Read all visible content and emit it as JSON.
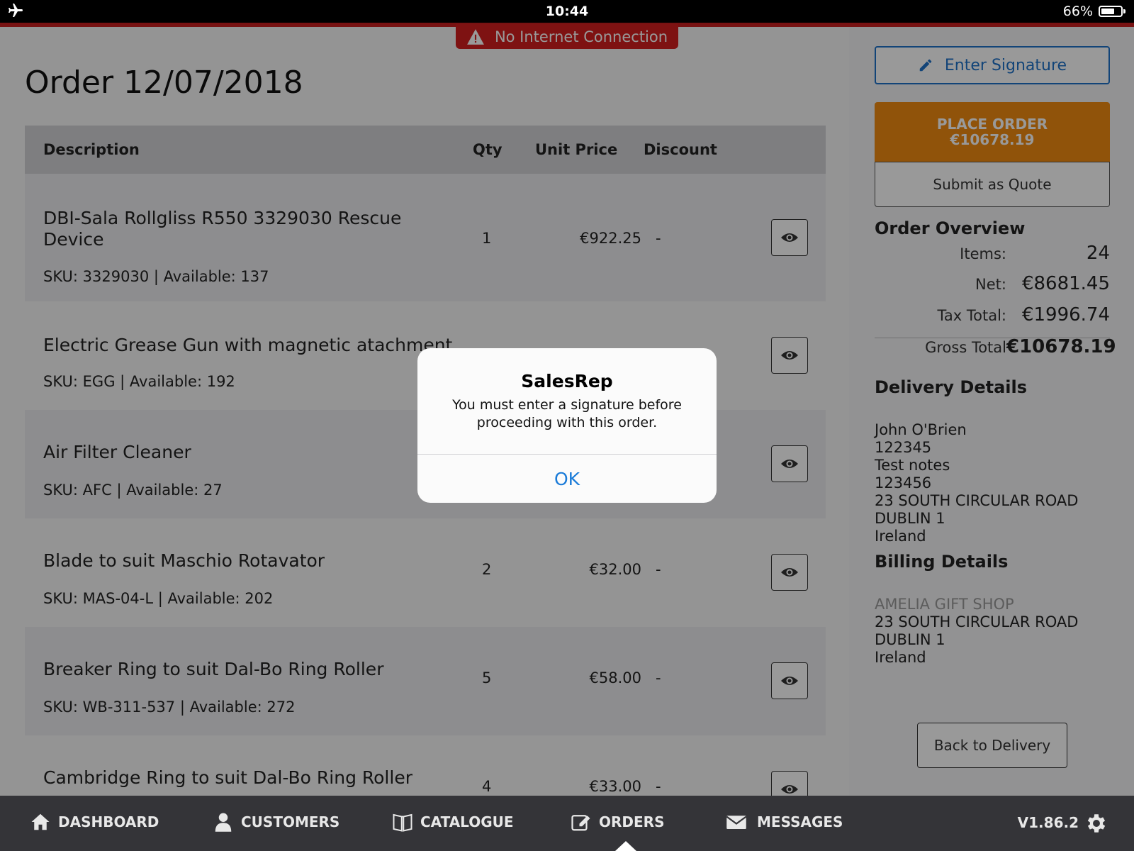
{
  "status_bar": {
    "time": "10:44",
    "battery": "66%"
  },
  "banner": {
    "text": "No Internet Connection"
  },
  "page": {
    "title": "Order 12/07/2018"
  },
  "table": {
    "headers": {
      "description": "Description",
      "qty": "Qty",
      "unit_price": "Unit Price",
      "discount": "Discount"
    },
    "rows": [
      {
        "description": "DBI-Sala Rollgliss R550 3329030 Rescue Device",
        "sku": "SKU: 3329030 | Available: 137",
        "qty": "1",
        "price": "€922.25",
        "discount": "-"
      },
      {
        "description": "Electric Grease Gun with magnetic atachment",
        "sku": "SKU: EGG | Available: 192",
        "qty": "",
        "price": "",
        "discount": ""
      },
      {
        "description": "Air Filter Cleaner",
        "sku": "SKU: AFC | Available: 27",
        "qty": "",
        "price": "",
        "discount": ""
      },
      {
        "description": "Blade to suit Maschio Rotavator",
        "sku": "SKU: MAS-04-L | Available: 202",
        "qty": "2",
        "price": "€32.00",
        "discount": "-"
      },
      {
        "description": "Breaker Ring to suit Dal-Bo Ring Roller",
        "sku": "SKU: WB-311-537 | Available: 272",
        "qty": "5",
        "price": "€58.00",
        "discount": "-"
      },
      {
        "description": "Cambridge Ring to suit Dal-Bo Ring Roller",
        "sku": "",
        "qty": "4",
        "price": "€33.00",
        "discount": "-"
      }
    ]
  },
  "sidebar": {
    "enter_signature": "Enter Signature",
    "place_order": "PLACE ORDER",
    "place_order_amount": "€10678.19",
    "submit_quote": "Submit as Quote",
    "overview": {
      "heading": "Order Overview",
      "items_label": "Items:",
      "items_value": "24",
      "net_label": "Net:",
      "net_value": "€8681.45",
      "tax_label": "Tax Total:",
      "tax_value": "€1996.74",
      "gross_label": "Gross Total",
      "gross_value": "€10678.19"
    },
    "delivery": {
      "heading": "Delivery Details",
      "lines": [
        "John O'Brien",
        "122345",
        "Test notes",
        "123456",
        "23 SOUTH CIRCULAR ROAD",
        "DUBLIN 1",
        "Ireland"
      ]
    },
    "billing": {
      "heading": "Billing Details",
      "company": "AMELIA GIFT SHOP",
      "lines": [
        "23 SOUTH CIRCULAR ROAD",
        "DUBLIN 1",
        "Ireland"
      ]
    },
    "back_to_delivery": "Back to Delivery"
  },
  "dialog": {
    "title": "SalesRep",
    "message": "You must enter a signature before proceeding with this order.",
    "ok": "OK"
  },
  "nav": {
    "items": [
      {
        "label": "DASHBOARD",
        "icon": "home-icon"
      },
      {
        "label": "CUSTOMERS",
        "icon": "person-icon"
      },
      {
        "label": "CATALOGUE",
        "icon": "book-icon"
      },
      {
        "label": "ORDERS",
        "icon": "edit-icon"
      },
      {
        "label": "MESSAGES",
        "icon": "mail-icon"
      }
    ],
    "active": "ORDERS",
    "version": "V1.86.2"
  },
  "colors": {
    "accent_blue": "#1f72c8",
    "place_order": "#f08b12",
    "alert_red": "#d21f1f",
    "nav_bg": "#343438"
  }
}
